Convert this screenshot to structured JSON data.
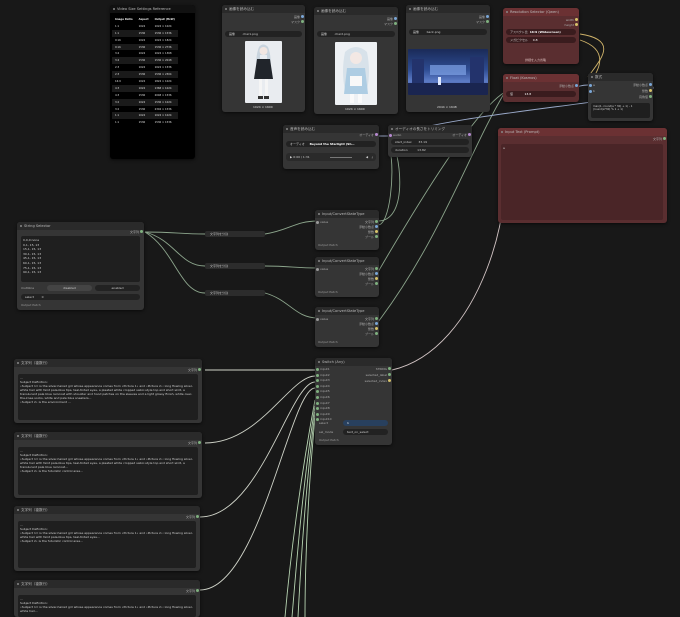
{
  "size_ref": {
    "title": "Video Size Settings Reference",
    "headers": [
      "Image Ratio",
      "Aspect",
      "Output (HxW)"
    ],
    "rows": [
      [
        "1:1",
        "1024",
        "1024 × 1024"
      ],
      [
        "1:1",
        "1536",
        "1536 × 1536"
      ],
      [
        "9:16",
        "1024",
        "1024 × 1824"
      ],
      [
        "9:16",
        "1536",
        "1536 × 2736"
      ],
      [
        "3:4",
        "1024",
        "1024 × 1368"
      ],
      [
        "3:4",
        "1536",
        "1536 × 2048"
      ],
      [
        "2:3",
        "1024",
        "1024 × 1536"
      ],
      [
        "2:3",
        "1536",
        "1536 × 2304"
      ],
      [
        "16:9",
        "1024",
        "1824 × 1024"
      ],
      [
        "4:3",
        "1024",
        "1368 × 1024"
      ],
      [
        "4:3",
        "1536",
        "2048 × 1536"
      ],
      [
        "3:2",
        "1024",
        "1536 × 1024"
      ],
      [
        "3:2",
        "1536",
        "2304 × 1536"
      ],
      [
        "1:1",
        "1024",
        "1024 × 1024"
      ],
      [
        "1:1",
        "1536",
        "1536 × 1536"
      ]
    ]
  },
  "load_images": [
    {
      "title": "画像を読み込む",
      "out1": "画像",
      "out2": "マスク",
      "label": "画像",
      "file": "char1.png",
      "dims": "1024 × 1600"
    },
    {
      "title": "画像を読み込む",
      "out1": "画像",
      "out2": "マスク",
      "label": "画像",
      "file": "char2.png",
      "dims": "1024 × 1600"
    },
    {
      "title": "画像を読み込む",
      "out1": "画像",
      "out2": "マスク",
      "label": "画像",
      "file": "back.png",
      "dims": "2944 × 1648"
    }
  ],
  "resolution": {
    "title": "Resolution Selector (Qwen)",
    "out1": "width",
    "out2": "height",
    "row1_label": "アスペクト比",
    "row1_value": "16:9 (Widescreen)",
    "row2_label": "メガピクセル",
    "row2_value": "0.8",
    "footer": "詳細を入力省略"
  },
  "float_node": {
    "title": "Float (Kosmos)",
    "out": "浮動小数点",
    "value": "13.8",
    "label": "値"
  },
  "calc_node": {
    "title": "数式",
    "in_a": "a",
    "in_b": "b",
    "out1": "浮動小数点",
    "out2": "整数",
    "out3": "真偽値",
    "formula": "max(1, round(a * 30) + 1) - 1 (round(a*30) % 1 + 1)"
  },
  "audio_node": {
    "title": "音声を読み込む",
    "out": "オーディオ",
    "label": "オーディオ",
    "file": "Beyond the Starlight (Sh…",
    "time": "0:00 / 1:31"
  },
  "audio_trim": {
    "title": "オーディオの長さをトリミング",
    "in": "audio",
    "out": "オーディオ",
    "row1_label": "start_index",
    "row1_value": "33.19",
    "row2_label": "duration",
    "row2_value": "13.82"
  },
  "input_text": {
    "title": "Input Text (Prompt)",
    "out": "文字列",
    "value": "a"
  },
  "string_selector": {
    "title": "String Selector",
    "out": "文字列",
    "text": "0,0,0:none\n0,1, 15, 13\n15,1, 15, 13\n30,1, 15, 13\n45,1, 15, 13\n60,1, 15, 13\n75,1, 15, 13\n90,1, 15, 13",
    "multiline_label": "multiline",
    "multiline_value": "disabled",
    "multiline_alt": "enabled",
    "select_label": "select",
    "select_value": "0",
    "footer": "Output Patch"
  },
  "split_nodes": [
    {
      "title": "文字列を分割"
    },
    {
      "title": "文字列を分割"
    },
    {
      "title": "文字列を分割"
    }
  ],
  "convert_nodes": [
    {
      "title": "Input/ConvertStateType",
      "in": "value",
      "o1": "文字列",
      "o2": "浮動小数点",
      "o3": "整数",
      "o4": "ブール",
      "footer": "Output Patch"
    },
    {
      "title": "Input/ConvertStateType",
      "in": "value",
      "o1": "文字列",
      "o2": "浮動小数点",
      "o3": "整数",
      "o4": "ブール",
      "footer": "Output Patch"
    },
    {
      "title": "Input/ConvertStateType",
      "in": "value",
      "o1": "文字列",
      "o2": "浮動小数点",
      "o3": "整数",
      "o4": "ブール",
      "footer": "Output Patch"
    }
  ],
  "switch_node": {
    "title": "Switch (Any)",
    "inputs": [
      "input1",
      "input2",
      "input3",
      "input4",
      "input5",
      "input6",
      "input7",
      "input8",
      "input9",
      "input10"
    ],
    "out1": "STRING",
    "out2": "selected_label",
    "out3": "selected_index",
    "select_label": "select",
    "select_value": "1",
    "sel_mode_label": "sel_mode",
    "sel_mode_value": "text_on_select",
    "footer": "Output Patch"
  },
  "text_nodes": [
    {
      "title": "文字列（複数行）",
      "out": "文字列",
      "text": "...\nSubject Definition:\n•Subject 1= is the silver-haired girl whose appearance comes from •Picture 1• and •Picture 2•: long flowing silver-white hair with faint pale-blue tips, teal-tinted eyes, a pleated white cropped sailor-style top and short skirt, a translucent pale blue raincoat with shoulder and hood patches on the sleeves and a light glossy finish, white over-the-knee socks, white and pale blue sneakers...\n•Subject 2• is the environment ..."
    },
    {
      "title": "文字列（複数行）",
      "out": "文字列",
      "text": "...\nSubject Definition:\n•Subject 1= is the silver-haired girl whose appearance comes from •Picture 1• and •Picture 2•: long flowing silver-white hair with faint pale-blue tips, teal-tinted eyes, a pleated white cropped sailor-style top and short skirt, a translucent pale blue raincoat...\n•Subject 2• is the futuristic control area..."
    },
    {
      "title": "文字列（複数行）",
      "out": "文字列",
      "text": "...\nSubject Definition:\n•Subject 1= is the silver-haired girl whose appearance comes from •Picture 1• and •Picture 2•: long flowing silver-white hair with faint pale-blue tips, teal-tinted eyes...\n•Subject 2• is the futuristic control area..."
    },
    {
      "title": "文字列（複数行）",
      "out": "文字列",
      "text": "...\nSubject Definition:\n•Subject 1= is the silver-haired girl whose appearance comes from •Picture 1• and •Picture 2•: long flowing silver-white hair..."
    }
  ]
}
